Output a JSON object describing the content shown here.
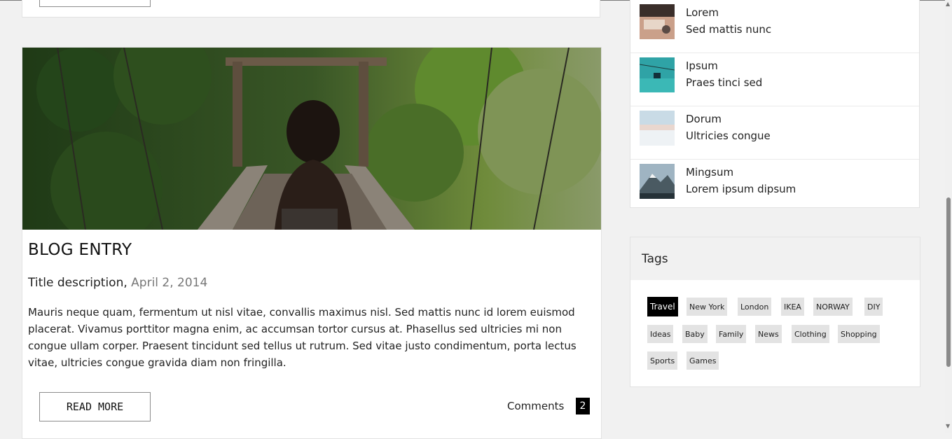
{
  "blog": {
    "title": "BLOG ENTRY",
    "subtitle": "Title description,",
    "date": "April 2, 2014",
    "body": "Mauris neque quam, fermentum ut nisl vitae, convallis maximus nisl. Sed mattis nunc id lorem euismod placerat. Vivamus porttitor magna enim, ac accumsan tortor cursus at. Phasellus sed ultricies mi non congue ullam corper. Praesent tincidunt sed tellus ut rutrum. Sed vitae justo condimentum, porta lectus vitae, ultricies congue gravida diam non fringilla.",
    "read_more": "READ MORE",
    "comments_label": "Comments",
    "comments_count": "2"
  },
  "popular_posts": [
    {
      "name": "Lorem",
      "desc": "Sed mattis nunc"
    },
    {
      "name": "Ipsum",
      "desc": "Praes tinci sed"
    },
    {
      "name": "Dorum",
      "desc": "Ultricies congue"
    },
    {
      "name": "Mingsum",
      "desc": "Lorem ipsum dipsum"
    }
  ],
  "tags": {
    "title": "Tags",
    "items": [
      "Travel",
      "New York",
      "London",
      "IKEA",
      "NORWAY",
      "DIY",
      "Ideas",
      "Baby",
      "Family",
      "News",
      "Clothing",
      "Shopping",
      "Sports",
      "Games"
    ],
    "active": "Travel"
  },
  "colors": {
    "page_bg": "#f1f1f1",
    "active_tag_bg": "#000000",
    "tag_bg": "#e3e3e3"
  }
}
